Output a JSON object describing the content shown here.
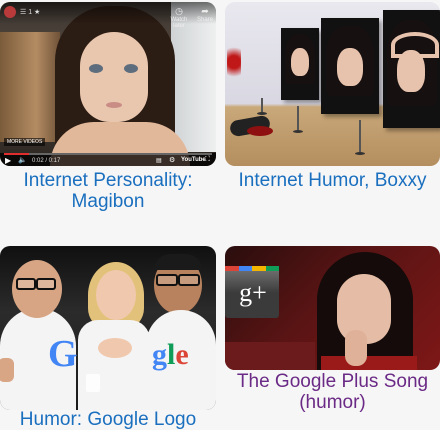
{
  "cards": [
    {
      "caption": "Internet Personality: Magibon",
      "video": {
        "channel_dots": "☰ 1 ★",
        "watch_later": "Watch later",
        "share": "Share",
        "more_videos": "MORE VIDEOS",
        "time": "0:02 / 0:17",
        "brand": "YouTube",
        "progress": 0.12,
        "progress_color": "#e12d2d"
      }
    },
    {
      "caption": "Internet Humor, Boxxy"
    },
    {
      "caption": "Humor: Google Logo"
    },
    {
      "caption": "The Google Plus Song (humor)",
      "logo_text": "g+"
    }
  ],
  "colors": {
    "link": "#1a6fbf",
    "visited": "#6b2a86",
    "google_blue": "#4285f4",
    "google_red": "#db4437",
    "google_yellow": "#f4b400",
    "google_green": "#0f9d58"
  }
}
